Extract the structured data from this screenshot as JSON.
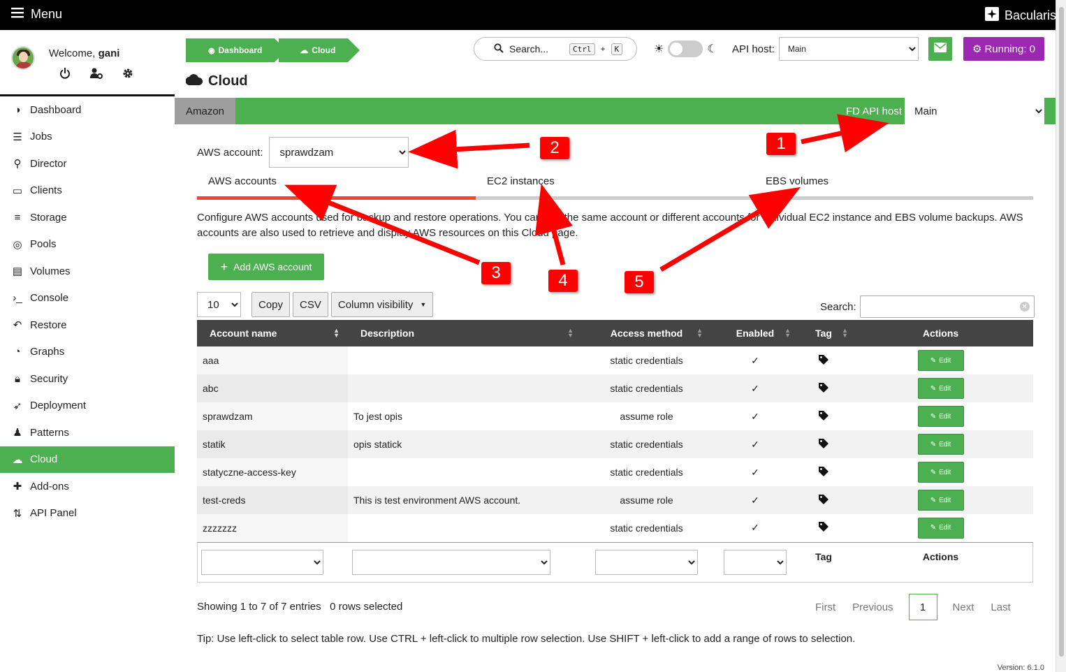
{
  "topbar": {
    "menu_label": "Menu",
    "brand": "Bacularis"
  },
  "user": {
    "welcome": "Welcome,",
    "name": "gani"
  },
  "nav": {
    "items": [
      {
        "label": "Dashboard",
        "icon": "dashboard-icon"
      },
      {
        "label": "Jobs",
        "icon": "jobs-icon"
      },
      {
        "label": "Director",
        "icon": "director-icon"
      },
      {
        "label": "Clients",
        "icon": "clients-icon"
      },
      {
        "label": "Storage",
        "icon": "storage-icon"
      },
      {
        "label": "Pools",
        "icon": "pools-icon"
      },
      {
        "label": "Volumes",
        "icon": "volumes-icon"
      },
      {
        "label": "Console",
        "icon": "console-icon"
      },
      {
        "label": "Restore",
        "icon": "restore-icon"
      },
      {
        "label": "Graphs",
        "icon": "graphs-icon"
      },
      {
        "label": "Security",
        "icon": "lock-icon"
      },
      {
        "label": "Deployment",
        "icon": "rocket-icon"
      },
      {
        "label": "Patterns",
        "icon": "patterns-icon"
      },
      {
        "label": "Cloud",
        "icon": "cloud-icon",
        "active": true
      },
      {
        "label": "Add-ons",
        "icon": "puzzle-icon"
      },
      {
        "label": "API Panel",
        "icon": "api-icon"
      }
    ]
  },
  "breadcrumb": {
    "dashboard": "Dashboard",
    "cloud": "Cloud"
  },
  "search": {
    "label": "Search...",
    "key1": "Ctrl",
    "plus": "+",
    "key2": "K"
  },
  "apihost": {
    "label": "API host:",
    "value": "Main"
  },
  "running": {
    "label": "Running: 0"
  },
  "page": {
    "title": "Cloud"
  },
  "cloudbar": {
    "tab": "Amazon",
    "fd_label": "FD API host",
    "fd_value": "Main"
  },
  "aws": {
    "label": "AWS account:",
    "value": "sprawdzam"
  },
  "tabs": [
    "AWS accounts",
    "EC2 instances",
    "EBS volumes"
  ],
  "description": "Configure AWS accounts used for backup and restore operations. You can use the same account or different accounts for individual EC2 instance and EBS volume backups. AWS accounts are also used to retrieve and display AWS resources on this Cloud page.",
  "add_button": "Add AWS account",
  "table_tools": {
    "page_size": "10",
    "copy": "Copy",
    "csv": "CSV",
    "colvis": "Column visibility",
    "search_label": "Search:"
  },
  "table": {
    "columns": [
      "Account name",
      "Description",
      "Access method",
      "Enabled",
      "Tag",
      "Actions"
    ],
    "edit_label": "Edit",
    "rows": [
      {
        "name": "aaa",
        "desc": "",
        "method": "static credentials"
      },
      {
        "name": "abc",
        "desc": "",
        "method": "static credentials"
      },
      {
        "name": "sprawdzam",
        "desc": "To jest opis",
        "method": "assume role"
      },
      {
        "name": "statik",
        "desc": "opis statick",
        "method": "static credentials"
      },
      {
        "name": "statyczne-access-key",
        "desc": "",
        "method": "static credentials"
      },
      {
        "name": "test-creds",
        "desc": "This is test environment AWS account.",
        "method": "assume role"
      },
      {
        "name": "zzzzzzz",
        "desc": "",
        "method": "static credentials"
      }
    ],
    "footer_tag": "Tag",
    "footer_actions": "Actions"
  },
  "info": {
    "showing": "Showing 1 to 7 of 7 entries",
    "selected": "0 rows selected"
  },
  "pager": {
    "first": "First",
    "previous": "Previous",
    "current": "1",
    "next": "Next",
    "last": "Last"
  },
  "tip": "Tip: Use left-click to select table row. Use CTRL + left-click to multiple row selection. Use SHIFT + left-click to add a range of rows to selection.",
  "version": "Version: 6.1.0",
  "annotations": [
    "1",
    "2",
    "3",
    "4",
    "5"
  ],
  "colors": {
    "green": "#4caf50",
    "purple": "#9c27b0",
    "red": "#f44336",
    "dark": "#444444"
  }
}
